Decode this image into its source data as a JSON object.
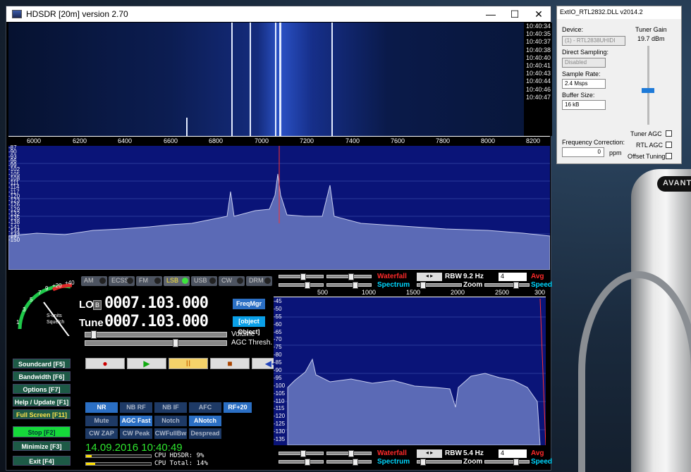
{
  "main_window": {
    "title": "HDSDR [20m]  version 2.70",
    "ctrl_min": "—",
    "ctrl_max": "☐",
    "ctrl_close": "✕"
  },
  "waterfall": {
    "timestamps": [
      "10:40:34",
      "10:40:35",
      "10:40:37",
      "10:40:38",
      "10:40:40",
      "10:40:41",
      "10:40:43",
      "10:40:44",
      "10:40:46",
      "10:40:47"
    ]
  },
  "rf_scale": [
    "6000",
    "6200",
    "6400",
    "6600",
    "6800",
    "7000",
    "7200",
    "7400",
    "7600",
    "7800",
    "8000",
    "8200"
  ],
  "rf_db_scale": [
    "-87",
    "-90",
    "-93",
    "-96",
    "-99",
    "-102",
    "-105",
    "-108",
    "-111",
    "-114",
    "-117",
    "-120",
    "-123",
    "-126",
    "-129",
    "-132",
    "-135",
    "-138",
    "-141",
    "-144",
    "-147",
    "-150"
  ],
  "smeter": {
    "label1": "S-units",
    "label2": "Squelch",
    "ticks": [
      "1",
      "3",
      "5",
      "7",
      "9",
      "+20",
      "+40"
    ]
  },
  "modes": [
    {
      "label": "AM"
    },
    {
      "label": "ECSS"
    },
    {
      "label": "FM"
    },
    {
      "label": "LSB"
    },
    {
      "label": "USB"
    },
    {
      "label": "CW"
    },
    {
      "label": "DRM"
    }
  ],
  "lo": {
    "label": "LO",
    "badge": "B",
    "freq": "0007.103.000"
  },
  "tune": {
    "label": "Tune",
    "freq": "0007.103.000"
  },
  "freqmgr": "FreqMgr",
  "extio": {
    "title": "ExtIO_RTL2832.DLL v2014.2",
    "device_label": "Device:",
    "device": "(1) - RTL2838UHIDI",
    "direct_label": "Direct Sampling:",
    "direct": "Disabled",
    "rate_label": "Sample Rate:",
    "rate": "2.4 Msps",
    "buffer_label": "Buffer Size:",
    "buffer": "16 kB",
    "freqcorr_label": "Frequency Correction:",
    "freqcorr": "0",
    "ppm": "ppm",
    "gain_label": "Tuner Gain",
    "gain": "19.7",
    "gain_unit": "dBm",
    "tuner_agc": "Tuner AGC",
    "rtl_agc": "RTL AGC",
    "offset": "Offset Tuning"
  },
  "volume": "Volume",
  "agc_thresh": "AGC Thresh.",
  "side_buttons": [
    {
      "label": "Soundcard",
      "key": "[F5]"
    },
    {
      "label": "Bandwidth",
      "key": "[F6]"
    },
    {
      "label": "Options",
      "key": "[F7]"
    },
    {
      "label": "Help / Update",
      "key": "[F1]"
    },
    {
      "label": "Full Screen",
      "key": "[F11]"
    },
    {
      "label": "Stop",
      "key": "[F2]"
    },
    {
      "label": "Minimize",
      "key": "[F3]"
    },
    {
      "label": "Exit",
      "key": "[F4]"
    }
  ],
  "transport": {
    "rec": "●",
    "play": "▶",
    "pause": "II",
    "stop": "■",
    "rew": "◀◀",
    "loop": "∞"
  },
  "dsp_row1": [
    "NR",
    "NB RF",
    "NB IF",
    "AFC",
    "RF+20"
  ],
  "dsp_row2": [
    "Mute",
    "AGC Fast",
    "Notch",
    "ANotch"
  ],
  "dsp_row3": [
    "CW ZAP",
    "CW Peak",
    "CWFullBw",
    "Despread"
  ],
  "datetime": "14.09.2016 10:40:49",
  "cpu": {
    "hdsdr_label": "CPU HDSDR:",
    "hdsdr": "9%",
    "total_label": "CPU Total:",
    "total": "14%"
  },
  "rf_panel": {
    "waterfall": "Waterfall",
    "spectrum": "Spectrum",
    "rbw_label": "RBW",
    "rbw": "9.2 Hz",
    "avg_sel": "4",
    "avg": "Avg",
    "zoom": "Zoom",
    "speed": "Speed"
  },
  "af_panel": {
    "waterfall": "Waterfall",
    "spectrum": "Spectrum",
    "rbw_label": "RBW",
    "rbw": "5.4 Hz",
    "avg_sel": "4",
    "avg": "Avg",
    "zoom": "Zoom",
    "speed": "Speed"
  },
  "af_scale": [
    "500",
    "1000",
    "1500",
    "2000",
    "2500",
    "300"
  ],
  "af_db_scale": [
    "-45",
    "-50",
    "-55",
    "-60",
    "-65",
    "-70",
    "-75",
    "-80",
    "-85",
    "-90",
    "-95",
    "-100",
    "-105",
    "-110",
    "-115",
    "-120",
    "-125",
    "-130",
    "-135"
  ],
  "mic_brand": "AVANT"
}
